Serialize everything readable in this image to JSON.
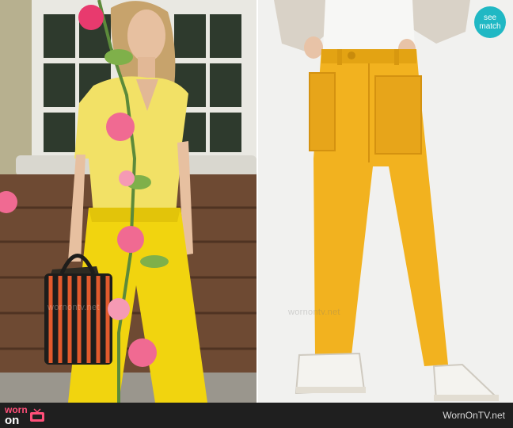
{
  "badge": {
    "line1": "see",
    "line2": "match",
    "color": "#20b8c4"
  },
  "watermarks": {
    "left_text": "wornontv.net",
    "right_text": "wornontv.net"
  },
  "footer": {
    "logo_top": "worn",
    "logo_bottom": "on",
    "logo_icon": "tv-icon",
    "url": "WornOnTV.net",
    "bg_color": "#1f1f1f",
    "accent_color": "#ff4f79"
  }
}
